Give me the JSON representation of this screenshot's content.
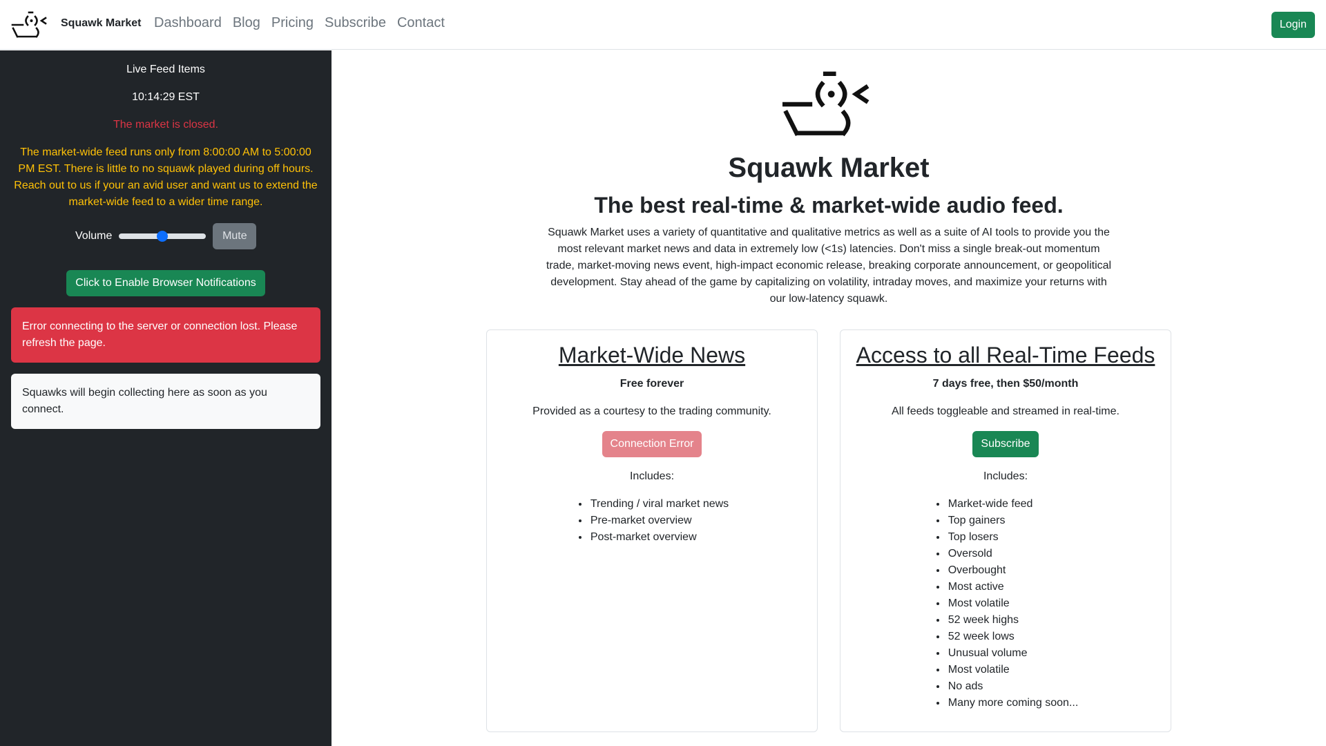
{
  "nav": {
    "brand": "Squawk Market",
    "links": [
      "Dashboard",
      "Blog",
      "Pricing",
      "Subscribe",
      "Contact"
    ],
    "login_label": "Login"
  },
  "sidebar": {
    "title": "Live Feed Items",
    "time": "10:14:29 EST",
    "market_status": "The market is closed.",
    "hours_notice": "The market-wide feed runs only from 8:00:00 AM to 5:00:00 PM EST. There is little to no squawk played during off hours. Reach out to us if your an avid user and want us to extend the market-wide feed to a wider time range.",
    "volume_label": "Volume",
    "volume_level": 0.5,
    "mute_label": "Mute",
    "notify_label": "Click to Enable Browser Notifications",
    "error_message": "Error connecting to the server or connection lost. Please refresh the page.",
    "squawk_placeholder": "Squawks will begin collecting here as soon as you connect."
  },
  "hero": {
    "title": "Squawk Market",
    "subtitle": "The best real-time & market-wide audio feed.",
    "description": "Squawk Market uses a variety of quantitative and qualitative metrics as well as a suite of AI tools to provide you the most relevant market news and data in extremely low (<1s) latencies. Don't miss a single break-out momentum trade, market-moving news event, high-impact economic release, breaking corporate announcement, or geopolitical development. Stay ahead of the game by capitalizing on volatility, intraday moves, and maximize your returns with our low-latency squawk."
  },
  "plans": {
    "free": {
      "title": "Market-Wide News",
      "price": "Free forever",
      "text": "Provided as a courtesy to the trading community.",
      "button": "Connection Error",
      "includes_label": "Includes:",
      "features": [
        "Trending / viral market news",
        "Pre-market overview",
        "Post-market overview"
      ]
    },
    "paid": {
      "title": "Access to all Real-Time Feeds",
      "price": "7 days free, then $50/month",
      "text": "All feeds toggleable and streamed in real-time.",
      "button": "Subscribe",
      "includes_label": "Includes:",
      "features": [
        "Market-wide feed",
        "Top gainers",
        "Top losers",
        "Oversold",
        "Overbought",
        "Most active",
        "Most volatile",
        "52 week highs",
        "52 week lows",
        "Unusual volume",
        "Most volatile",
        "No ads",
        "Many more coming soon..."
      ]
    }
  },
  "colors": {
    "primary_green": "#198754",
    "danger_red": "#dc3545",
    "warning_yellow": "#ffc107",
    "sidebar_bg": "#212529"
  }
}
